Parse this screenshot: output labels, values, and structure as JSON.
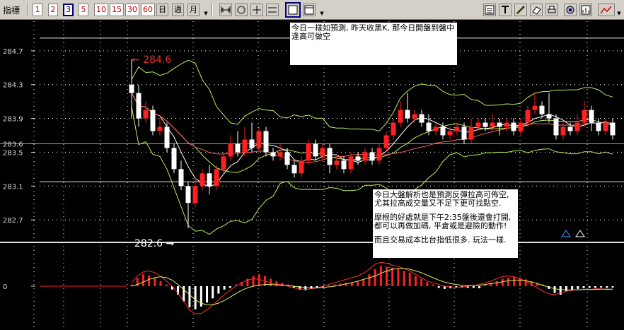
{
  "toolbar": {
    "label": "指標",
    "period_buttons": [
      "1",
      "2",
      "3",
      "5",
      "10",
      "15",
      "30",
      "60"
    ],
    "day_button": "日",
    "week_button": "週",
    "month_button": "月",
    "active_period": "3"
  },
  "colors": {
    "up": "#ff2020",
    "down": "#ffffff",
    "band": "#b8f05a",
    "ma": "#ffffff",
    "macd_line": "#ff3030",
    "signal_line": "#d8f060",
    "grid": "#ffffff",
    "price_line": "#5ab8ff"
  },
  "chart_data": [
    {
      "type": "candlestick",
      "title": "",
      "y_ticks": [
        "284.7",
        "284.3",
        "283.9",
        "283.6",
        "283.5",
        "283.1",
        "282.7"
      ],
      "ylim": [
        282.45,
        285.05
      ],
      "highlight_price": "283.6",
      "annotations": [
        {
          "text": "← 284.6"
        },
        {
          "text": "282.6 →"
        }
      ],
      "bollinger": true,
      "candles": [
        [
          284.3,
          284.2,
          284.6,
          283.9
        ],
        [
          284.2,
          283.9,
          284.3,
          283.8
        ],
        [
          283.9,
          284.0,
          284.1,
          283.85
        ],
        [
          284.0,
          283.75,
          284.05,
          283.7
        ],
        [
          283.75,
          283.8,
          283.9,
          283.7
        ],
        [
          283.8,
          283.55,
          283.85,
          283.5
        ],
        [
          283.55,
          283.3,
          283.6,
          283.25
        ],
        [
          283.3,
          283.1,
          283.4,
          283.05
        ],
        [
          283.1,
          282.9,
          283.15,
          282.6
        ],
        [
          282.9,
          283.1,
          283.2,
          282.85
        ],
        [
          283.1,
          283.25,
          283.3,
          283.05
        ],
        [
          283.25,
          283.1,
          283.35,
          283.0
        ],
        [
          283.1,
          283.3,
          283.35,
          283.05
        ],
        [
          283.3,
          283.45,
          283.5,
          283.25
        ],
        [
          283.45,
          283.6,
          283.7,
          283.4
        ],
        [
          283.6,
          283.5,
          283.75,
          283.45
        ],
        [
          283.5,
          283.65,
          283.8,
          283.45
        ],
        [
          283.65,
          283.55,
          283.85,
          283.5
        ],
        [
          283.55,
          283.75,
          283.8,
          283.5
        ],
        [
          283.75,
          283.5,
          283.8,
          283.45
        ],
        [
          283.5,
          283.45,
          283.55,
          283.4
        ],
        [
          283.45,
          283.5,
          283.6,
          283.4
        ],
        [
          283.5,
          283.35,
          283.55,
          283.3
        ],
        [
          283.35,
          283.25,
          283.4,
          283.2
        ],
        [
          283.25,
          283.4,
          283.45,
          283.2
        ],
        [
          283.4,
          283.6,
          283.65,
          283.35
        ],
        [
          283.6,
          283.45,
          283.65,
          283.4
        ],
        [
          283.45,
          283.55,
          283.6,
          283.4
        ],
        [
          283.55,
          283.35,
          283.6,
          283.25
        ],
        [
          283.35,
          283.4,
          283.45,
          283.3
        ],
        [
          283.4,
          283.3,
          283.45,
          283.25
        ],
        [
          283.3,
          283.45,
          283.5,
          283.25
        ],
        [
          283.45,
          283.4,
          283.5,
          283.35
        ],
        [
          283.4,
          283.5,
          283.55,
          283.35
        ],
        [
          283.5,
          283.4,
          283.55,
          283.35
        ],
        [
          283.4,
          283.55,
          283.6,
          283.35
        ],
        [
          283.55,
          283.7,
          283.75,
          283.5
        ],
        [
          283.7,
          283.85,
          283.9,
          283.65
        ],
        [
          283.85,
          284.0,
          284.1,
          283.8
        ],
        [
          284.0,
          283.9,
          284.2,
          283.85
        ],
        [
          283.9,
          283.95,
          284.0,
          283.85
        ],
        [
          283.95,
          283.85,
          284.0,
          283.8
        ],
        [
          283.85,
          283.75,
          283.95,
          283.7
        ],
        [
          283.75,
          283.8,
          283.85,
          283.7
        ],
        [
          283.8,
          283.7,
          283.85,
          283.65
        ],
        [
          283.7,
          283.75,
          283.8,
          283.65
        ],
        [
          283.75,
          283.8,
          283.85,
          283.7
        ],
        [
          283.8,
          283.65,
          283.85,
          283.6
        ],
        [
          283.65,
          283.8,
          283.9,
          283.6
        ],
        [
          283.8,
          283.85,
          283.9,
          283.75
        ],
        [
          283.85,
          283.8,
          283.9,
          283.75
        ],
        [
          283.8,
          283.85,
          283.95,
          283.75
        ],
        [
          283.85,
          283.8,
          283.9,
          283.7
        ],
        [
          283.8,
          283.85,
          283.9,
          283.75
        ],
        [
          283.85,
          283.75,
          283.9,
          283.7
        ],
        [
          283.75,
          283.85,
          283.9,
          283.7
        ],
        [
          283.85,
          284.0,
          284.05,
          283.8
        ],
        [
          284.0,
          284.05,
          284.2,
          283.95
        ],
        [
          284.05,
          283.95,
          284.1,
          283.9
        ],
        [
          283.95,
          283.9,
          284.2,
          283.85
        ],
        [
          283.9,
          283.7,
          283.95,
          283.65
        ],
        [
          283.7,
          283.8,
          283.85,
          283.65
        ],
        [
          283.8,
          283.75,
          283.85,
          283.7
        ],
        [
          283.75,
          283.85,
          283.95,
          283.7
        ],
        [
          283.85,
          284.0,
          284.1,
          283.8
        ],
        [
          284.0,
          283.85,
          284.05,
          283.75
        ],
        [
          283.85,
          283.75,
          283.9,
          283.7
        ],
        [
          283.75,
          283.85,
          283.9,
          283.7
        ],
        [
          283.85,
          283.7,
          283.9,
          283.65
        ]
      ]
    },
    {
      "type": "bar",
      "title": "",
      "y_ticks": [
        "0"
      ],
      "ylim": [
        -1,
        1
      ],
      "histogram": [
        0.05,
        0.25,
        0.35,
        0.32,
        0.25,
        0.15,
        0.05,
        -0.1,
        -0.25,
        -0.45,
        -0.62,
        -0.68,
        -0.6,
        -0.48,
        -0.36,
        -0.22,
        -0.1,
        -0.05,
        0.05,
        0.12,
        0.22,
        0.3,
        0.35,
        0.3,
        0.22,
        0.15,
        0.1,
        0.05,
        -0.05,
        -0.1,
        -0.12,
        -0.08,
        -0.05,
        -0.03,
        0.02,
        0.05,
        0.08,
        0.1,
        0.12,
        0.15,
        0.2,
        0.35,
        0.5,
        0.6,
        0.58,
        0.55,
        0.5,
        0.45,
        0.4,
        0.3,
        0.22,
        0.12,
        0.05,
        -0.05,
        -0.08,
        -0.06,
        -0.05,
        -0.04,
        -0.05,
        -0.05,
        -0.06,
        0.05,
        0.1,
        0.15,
        0.22,
        0.25,
        0.28,
        0.25,
        0.2,
        0.15,
        0.1,
        0.05,
        -0.08,
        -0.2,
        -0.25,
        -0.15,
        -0.1,
        -0.08,
        -0.06,
        -0.05,
        -0.05,
        -0.04,
        -0.05,
        -0.04
      ],
      "macd": [
        0.1,
        0.3,
        0.42,
        0.45,
        0.4,
        0.3,
        0.15,
        0.0,
        -0.2,
        -0.45,
        -0.7,
        -0.82,
        -0.8,
        -0.7,
        -0.55,
        -0.4,
        -0.25,
        -0.12,
        0.0,
        0.1,
        0.18,
        0.22,
        0.2,
        0.15,
        0.1,
        0.05,
        0.05,
        0.0,
        -0.05,
        -0.08,
        -0.1,
        -0.08,
        -0.05,
        0.0,
        0.05,
        0.1,
        0.15,
        0.2,
        0.25,
        0.3,
        0.38,
        0.5,
        0.65,
        0.7,
        0.68,
        0.62,
        0.58,
        0.52,
        0.45,
        0.35,
        0.25,
        0.15,
        0.1,
        0.05,
        0.0,
        -0.02,
        -0.03,
        -0.02,
        0.0,
        0.02,
        0.05,
        0.1,
        0.15,
        0.22,
        0.28,
        0.3,
        0.28,
        0.22,
        0.15,
        0.05,
        -0.05,
        -0.15,
        -0.22,
        -0.25,
        -0.2,
        -0.15,
        -0.12,
        -0.1,
        -0.1,
        -0.1,
        -0.08,
        -0.08,
        -0.1,
        -0.1
      ],
      "signal": [
        0.0,
        0.05,
        0.12,
        0.2,
        0.25,
        0.28,
        0.25,
        0.18,
        0.05,
        -0.1,
        -0.25,
        -0.4,
        -0.5,
        -0.55,
        -0.55,
        -0.5,
        -0.42,
        -0.32,
        -0.22,
        -0.12,
        -0.05,
        0.0,
        0.03,
        0.05,
        0.05,
        0.04,
        0.03,
        0.02,
        0.0,
        -0.02,
        -0.04,
        -0.05,
        -0.05,
        -0.04,
        -0.02,
        0.0,
        0.03,
        0.07,
        0.1,
        0.15,
        0.2,
        0.25,
        0.3,
        0.38,
        0.45,
        0.5,
        0.52,
        0.52,
        0.5,
        0.45,
        0.4,
        0.32,
        0.25,
        0.18,
        0.12,
        0.08,
        0.05,
        0.03,
        0.02,
        0.02,
        0.03,
        0.05,
        0.08,
        0.1,
        0.13,
        0.16,
        0.18,
        0.18,
        0.16,
        0.12,
        0.08,
        0.02,
        -0.03,
        -0.08,
        -0.1,
        -0.11,
        -0.11,
        -0.11,
        -0.1,
        -0.1,
        -0.1,
        -0.09,
        -0.09,
        -0.09
      ]
    }
  ],
  "notes": {
    "top": "今日一樣如預測, 昨天收黑K, 那今日開盤到盤中逢高可做空",
    "bottom_p1": "今日大盤解析也是預測反彈拉高可佈空, 尤其拉高成交量又不足下更可找點空.",
    "bottom_p2": "摩根的好處就是下午2:35盤後還會打開, 都可以再做加碼, 平倉或是避險的動作!",
    "bottom_p3": "而且交易成本比台指低很多. 玩法一樣."
  }
}
